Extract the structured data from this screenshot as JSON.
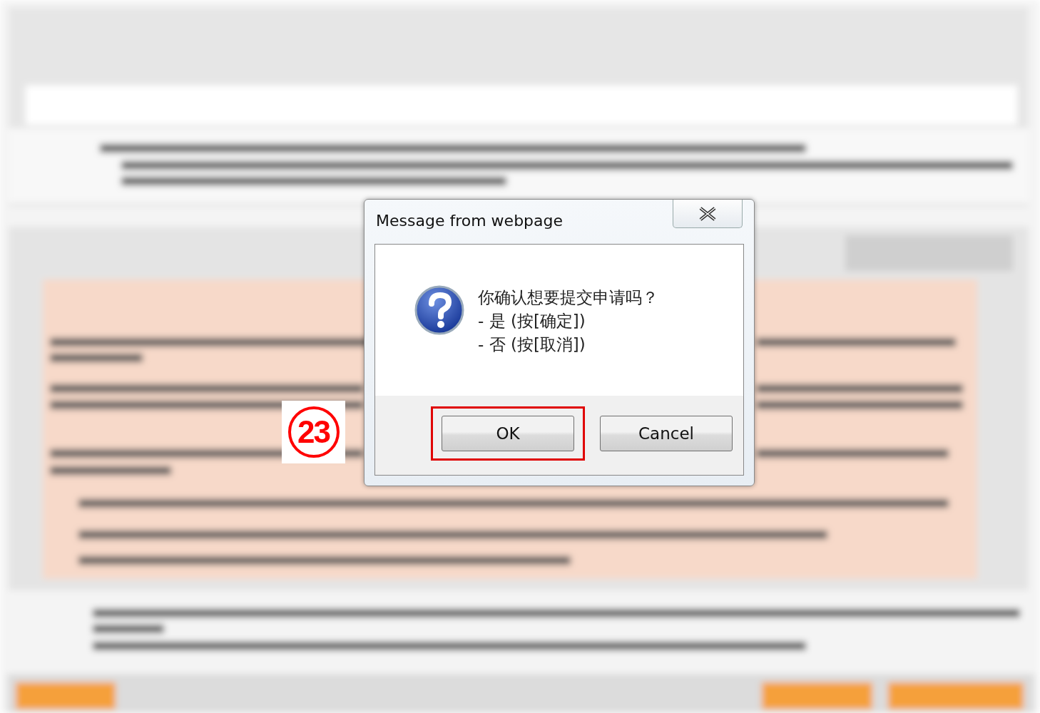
{
  "dialog": {
    "title": "Message from webpage",
    "message_lines": [
      "你确认想要提交申请吗？",
      "- 是 (按[确定])",
      "- 否 (按[取消])"
    ],
    "buttons": [
      {
        "label": "OK",
        "highlighted": true
      },
      {
        "label": "Cancel",
        "highlighted": false
      }
    ]
  },
  "step_badge": {
    "label": "23"
  }
}
